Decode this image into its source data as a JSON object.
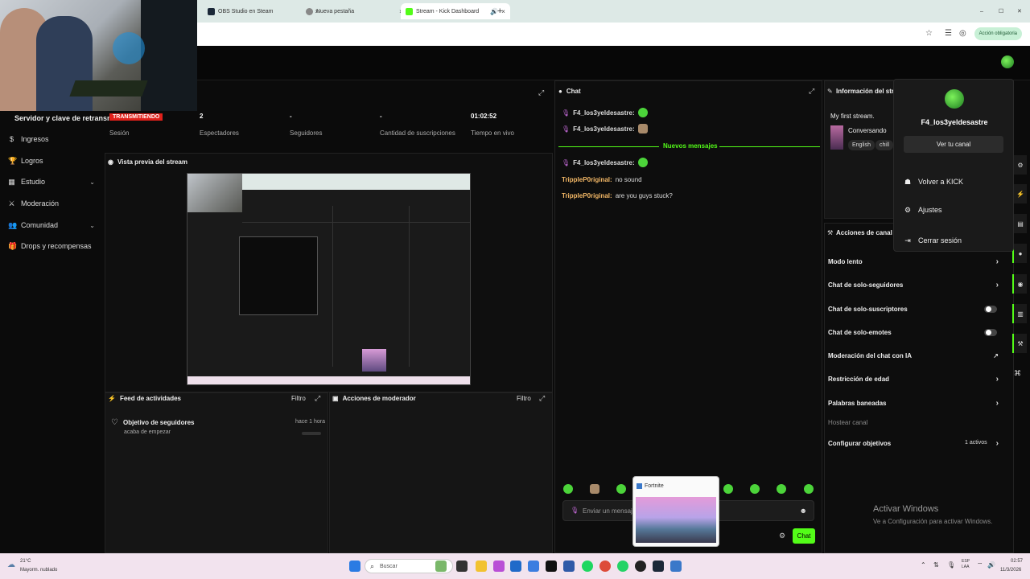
{
  "browser": {
    "tabs": [
      {
        "label": "OBS Studio en Steam",
        "close": "×"
      },
      {
        "label": "Nueva pestaña",
        "close": "×"
      },
      {
        "label": "Stream - Kick Dashboard",
        "close": "×"
      }
    ],
    "new_tab": "+",
    "extension_pill": "Acción obligatoria",
    "window_controls": [
      "–",
      "☐",
      "✕"
    ]
  },
  "sidebar": {
    "server_label": "Servidor y clave de retransm",
    "live_badge": "TRANSMITIENDO",
    "session_label": "Sesión",
    "items": [
      {
        "label": "Ingresos",
        "icon": "dollar-icon",
        "glyph": "$"
      },
      {
        "label": "Logros",
        "icon": "trophy-icon",
        "glyph": "🏆"
      },
      {
        "label": "Estudio",
        "icon": "studio-icon",
        "glyph": "▦",
        "chevron": "⌄"
      },
      {
        "label": "Moderación",
        "icon": "sword-icon",
        "glyph": "⚔"
      },
      {
        "label": "Comunidad",
        "icon": "community-icon",
        "glyph": "👥",
        "chevron": "⌄"
      },
      {
        "label": "Drops y recompensas",
        "icon": "gift-icon",
        "glyph": "🎁"
      }
    ]
  },
  "stats": [
    {
      "value": "2",
      "label": "Espectadores"
    },
    {
      "value": "-",
      "label": "Seguidores"
    },
    {
      "value": "-",
      "label": "Cantidad de suscripciones"
    },
    {
      "value": "01:02:52",
      "label": "Tiempo en vivo"
    }
  ],
  "preview": {
    "title": "Vista previa del stream"
  },
  "feed": {
    "title": "Feed de actividades",
    "filter": "Filtro",
    "items": [
      {
        "title": "Objetivo de seguidores",
        "subtitle": "acaba de empezar",
        "time": "hace 1 hora"
      }
    ]
  },
  "mod_actions": {
    "title": "Acciones de moderador",
    "filter": "Filtro"
  },
  "chat": {
    "title": "Chat",
    "messages_before": [
      {
        "user": "F4_los3yeldesastre:"
      },
      {
        "user": "F4_los3yeldesastre:"
      }
    ],
    "new_messages_label": "Nuevos mensajes",
    "messages_after": [
      {
        "user": "F4_los3yeldesastre:",
        "text": ""
      },
      {
        "user": "TrippleP0riginal:",
        "text": "no sound"
      },
      {
        "user": "TrippleP0riginal:",
        "text": "are you guys stuck?"
      }
    ],
    "input_placeholder": "Enviar un mensaje",
    "send_label": "Chat"
  },
  "fortnite_popup": {
    "title": "Fortnite"
  },
  "stream_info": {
    "title": "Información del strea",
    "stream_title": "My first stream.",
    "category": "Conversando",
    "tags": [
      "English",
      "chill"
    ]
  },
  "channel_actions": {
    "title": "Acciones de canal",
    "rows": [
      {
        "label": "Modo lento",
        "control": "›"
      },
      {
        "label": "Chat de solo-seguidores",
        "control": "›"
      },
      {
        "label": "Chat de solo-suscriptores",
        "control": "toggle",
        "on": false
      },
      {
        "label": "Chat de solo-emotes",
        "control": "toggle",
        "on": false
      },
      {
        "label": "Moderación del chat con IA",
        "control": "↗"
      },
      {
        "label": "Restricción de edad",
        "control": "›"
      },
      {
        "label": "Palabras baneadas",
        "control": "›"
      }
    ],
    "host_label": "Hostear canal",
    "goals_label": "Configurar objetivos",
    "goals_count": "1 activos"
  },
  "user_menu": {
    "username": "F4_los3yeldesastre",
    "channel_button": "Ver tu canal",
    "items": [
      {
        "label": "Volver a KICK",
        "glyph": "☗"
      },
      {
        "label": "Ajustes",
        "glyph": "⚙"
      },
      {
        "label": "Cerrar sesión",
        "glyph": "⇥"
      }
    ]
  },
  "windows_watermark": {
    "title": "Activar Windows",
    "subtitle": "Ve a Configuración para activar Windows."
  },
  "taskbar": {
    "weather_temp": "21°C",
    "weather_desc": "Mayorm. nublado",
    "search_placeholder": "Buscar",
    "lang": "ESP\nLAA",
    "time": "02:57",
    "date": "11/3/2026"
  },
  "colors": {
    "accent": "#53fc18",
    "live": "#e0201a",
    "username": "#f2b766"
  }
}
